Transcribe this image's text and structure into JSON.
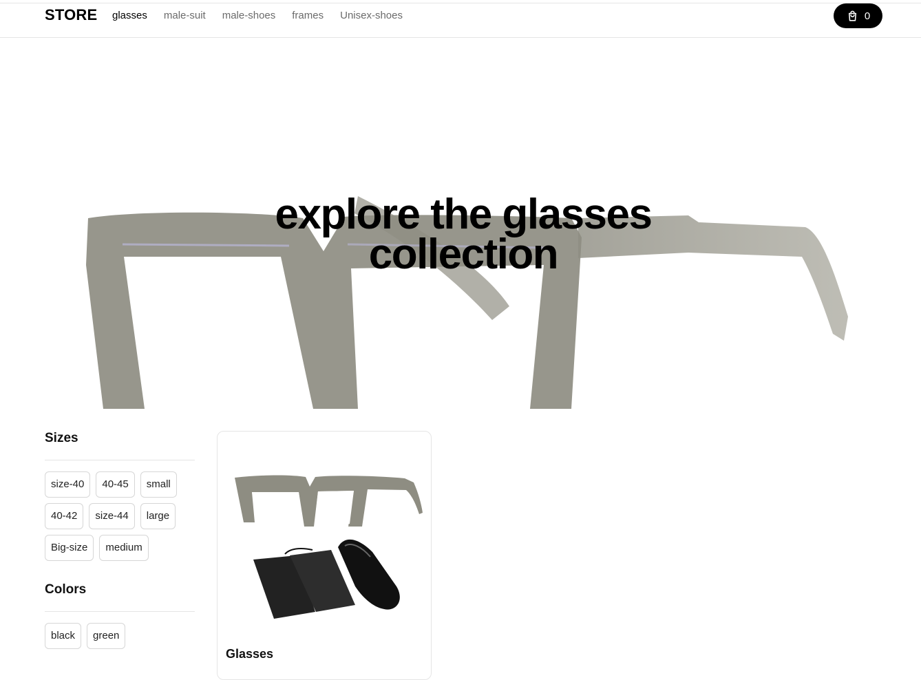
{
  "header": {
    "brand": "STORE",
    "nav": [
      "glasses",
      "male-suit",
      "male-shoes",
      "frames",
      "Unisex-shoes"
    ],
    "active_nav": "glasses",
    "cart_count": "0",
    "cart_icon": "shopping-bag-icon"
  },
  "hero": {
    "title": "explore the glasses collection",
    "image": "glasses-photo"
  },
  "filters": {
    "sizes": {
      "title": "Sizes",
      "options": [
        "size-40",
        "40-45",
        "small",
        "40-42",
        "size-44",
        "large",
        "Big-size",
        "medium"
      ]
    },
    "colors": {
      "title": "Colors",
      "options": [
        "black",
        "green"
      ]
    }
  },
  "products": [
    {
      "title": "Glasses",
      "image": "glasses-with-case-photo"
    }
  ],
  "colors": {
    "cart_bg": "#000000",
    "frame": "#8e8d82",
    "text": "#111111"
  }
}
